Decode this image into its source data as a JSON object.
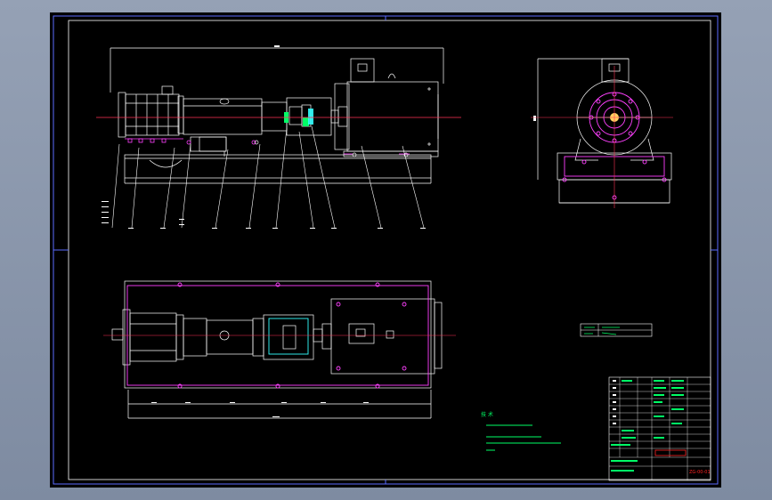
{
  "colors": {
    "background": "#000000",
    "frame": "#5b6cff",
    "geometry": "#ffffff",
    "centerline": "#ff3355",
    "dimension": "#ffffff",
    "accent_magenta": "#ff40ff",
    "accent_green": "#00ff66",
    "accent_cyan": "#33ffff",
    "title_red": "#ff2222"
  },
  "notes": {
    "heading": "技 术"
  },
  "title_block": {
    "drawing_no": "ZG-00-01"
  }
}
